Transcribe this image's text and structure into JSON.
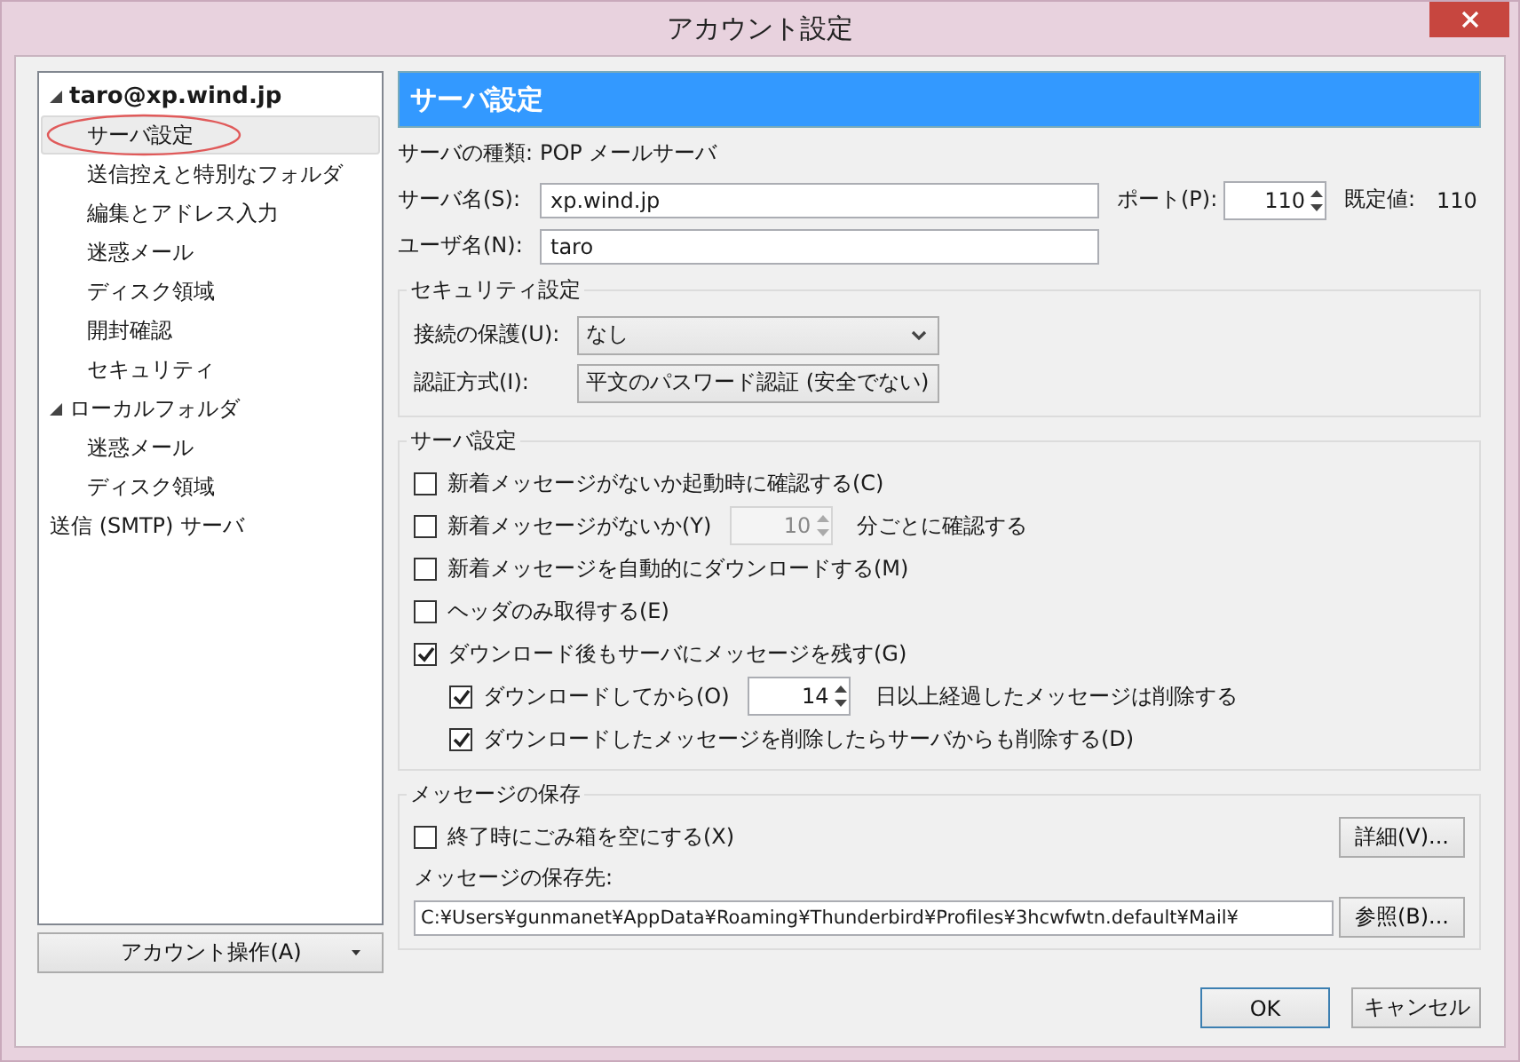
{
  "window": {
    "title": "アカウント設定"
  },
  "tree": [
    {
      "label": "taro@xp.wind.jp",
      "expanded": true,
      "selected": false,
      "children": [
        {
          "label": "サーバ設定",
          "selected": true,
          "circled": true
        },
        {
          "label": "送信控えと特別なフォルダ",
          "selected": false
        },
        {
          "label": "編集とアドレス入力",
          "selected": false
        },
        {
          "label": "迷惑メール",
          "selected": false
        },
        {
          "label": "ディスク領域",
          "selected": false
        },
        {
          "label": "開封確認",
          "selected": false
        },
        {
          "label": "セキュリティ",
          "selected": false
        }
      ]
    },
    {
      "label": "ローカルフォルダ",
      "expanded": true,
      "selected": false,
      "children": [
        {
          "label": "迷惑メール",
          "selected": false
        },
        {
          "label": "ディスク領域",
          "selected": false
        }
      ]
    },
    {
      "label": "送信 (SMTP) サーバ",
      "selected": false
    }
  ],
  "account_button": "アカウント操作(A)",
  "header": "サーバ設定",
  "server_type": {
    "label": "サーバの種類:",
    "value": "POP メールサーバ"
  },
  "server_name": {
    "label": "サーバ名(S):",
    "value": "xp.wind.jp"
  },
  "port": {
    "label": "ポート(P):",
    "value": "110",
    "default_label": "既定値:",
    "default_value": "110"
  },
  "user_name": {
    "label": "ユーザ名(N):",
    "value": "taro"
  },
  "security": {
    "title": "セキュリティ設定",
    "rows": [
      {
        "label": "接続の保護(U):",
        "value": "なし"
      },
      {
        "label": "認証方式(I):",
        "value": "平文のパスワード認証 (安全でない)"
      }
    ]
  },
  "server_settings": {
    "title": "サーバ設定",
    "options": [
      {
        "kind": "check",
        "label": "新着メッセージがないか起動時に確認する(C)",
        "checked": false
      },
      {
        "kind": "spin",
        "label": "新着メッセージがないか(Y)",
        "checked": false,
        "value": "10",
        "suffix": "分ごとに確認する",
        "disabled": true
      },
      {
        "kind": "check",
        "label": "新着メッセージを自動的にダウンロードする(M)",
        "checked": false
      },
      {
        "kind": "check",
        "label": "ヘッダのみ取得する(E)",
        "checked": false
      },
      {
        "kind": "check",
        "label": "ダウンロード後もサーバにメッセージを残す(G)",
        "checked": true,
        "children": [
          {
            "kind": "spin",
            "label": "ダウンロードしてから(O)",
            "checked": true,
            "value": "14",
            "suffix": "日以上経過したメッセージは削除する",
            "disabled": false
          },
          {
            "kind": "check",
            "label": "ダウンロードしたメッセージを削除したらサーバからも削除する(D)",
            "checked": true
          }
        ]
      }
    ]
  },
  "storage": {
    "title": "メッセージの保存",
    "empty_trash": {
      "label": "終了時にごみ箱を空にする(X)",
      "checked": false
    },
    "details_button": "詳細(V)...",
    "path_label": "メッセージの保存先:",
    "path": "C:¥Users¥gunmanet¥AppData¥Roaming¥Thunderbird¥Profiles¥3hcwfwtn.default¥Mail¥",
    "browse_button": "参照(B)..."
  },
  "buttons": [
    "OK",
    "キャンセル"
  ]
}
